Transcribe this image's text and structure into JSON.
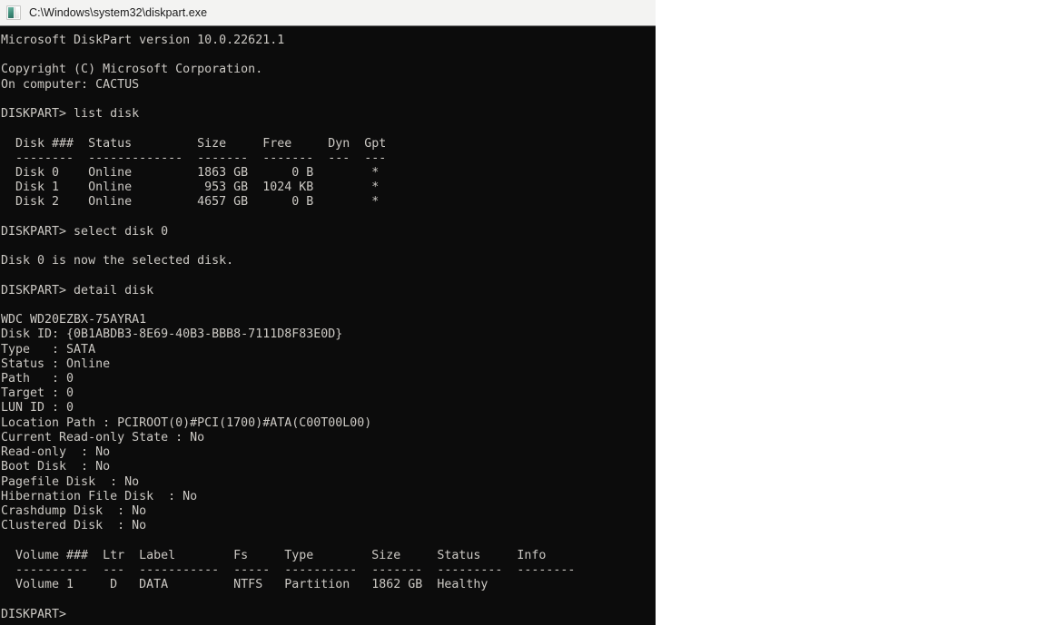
{
  "window": {
    "title": "C:\\Windows\\system32\\diskpart.exe",
    "icon": "console-icon",
    "background_color": "#0c0c0c",
    "title_bar_color": "#f3f3f2",
    "text_color": "#ccc9c4"
  },
  "console": {
    "header": {
      "version_line": "Microsoft DiskPart version 10.0.22621.1",
      "copyright": "Copyright (C) Microsoft Corporation.",
      "computer_line": "On computer: CACTUS",
      "computer_name": "CACTUS",
      "version": "10.0.22621.1"
    },
    "prompt": "DISKPART>",
    "commands": [
      "list disk",
      "select disk 0",
      "detail disk"
    ],
    "list_disk": {
      "headers": [
        "Disk ###",
        "Status",
        "Size",
        "Free",
        "Dyn",
        "Gpt"
      ],
      "separators": [
        "--------",
        "-------------",
        "-------",
        "-------",
        "---",
        "---"
      ],
      "rows": [
        {
          "disk": "Disk 0",
          "status": "Online",
          "size": "1863 GB",
          "free": "0 B",
          "dyn": "",
          "gpt": "*"
        },
        {
          "disk": "Disk 1",
          "status": "Online",
          "size": "953 GB",
          "free": "1024 KB",
          "dyn": "",
          "gpt": "*"
        },
        {
          "disk": "Disk 2",
          "status": "Online",
          "size": "4657 GB",
          "free": "0 B",
          "dyn": "",
          "gpt": "*"
        }
      ]
    },
    "select_disk_result": "Disk 0 is now the selected disk.",
    "detail_disk": {
      "model": "WDC WD20EZBX-75AYRA1",
      "disk_id_label": "Disk ID:",
      "disk_id": "{0B1ABDB3-8E69-40B3-BBB8-7111D8F83E0D}",
      "properties": [
        {
          "label": "Type",
          "value": "SATA"
        },
        {
          "label": "Status",
          "value": "Online"
        },
        {
          "label": "Path",
          "value": "0"
        },
        {
          "label": "Target",
          "value": "0"
        },
        {
          "label": "LUN ID",
          "value": "0"
        },
        {
          "label": "Location Path",
          "value": "PCIROOT(0)#PCI(1700)#ATA(C00T00L00)"
        },
        {
          "label": "Current Read-only State",
          "value": "No"
        },
        {
          "label": "Read-only",
          "value": "No"
        },
        {
          "label": "Boot Disk",
          "value": "No"
        },
        {
          "label": "Pagefile Disk",
          "value": "No"
        },
        {
          "label": "Hibernation File Disk",
          "value": "No"
        },
        {
          "label": "Crashdump Disk",
          "value": "No"
        },
        {
          "label": "Clustered Disk",
          "value": "No"
        }
      ],
      "volumes": {
        "headers": [
          "Volume ###",
          "Ltr",
          "Label",
          "Fs",
          "Type",
          "Size",
          "Status",
          "Info"
        ],
        "separators": [
          "----------",
          "---",
          "-----------",
          "-----",
          "----------",
          "-------",
          "---------",
          "--------"
        ],
        "rows": [
          {
            "volume": "Volume 1",
            "ltr": "D",
            "label": "DATA",
            "fs": "NTFS",
            "type": "Partition",
            "size": "1862 GB",
            "status": "Healthy",
            "info": ""
          }
        ]
      }
    },
    "trailing_prompt": "DISKPART>",
    "screen_text": "Microsoft DiskPart version 10.0.22621.1\n\nCopyright (C) Microsoft Corporation.\nOn computer: CACTUS\n\nDISKPART> list disk\n\n  Disk ###  Status         Size     Free     Dyn  Gpt\n  --------  -------------  -------  -------  ---  ---\n  Disk 0    Online         1863 GB      0 B        *\n  Disk 1    Online          953 GB  1024 KB        *\n  Disk 2    Online         4657 GB      0 B        *\n\nDISKPART> select disk 0\n\nDisk 0 is now the selected disk.\n\nDISKPART> detail disk\n\nWDC WD20EZBX-75AYRA1\nDisk ID: {0B1ABDB3-8E69-40B3-BBB8-7111D8F83E0D}\nType   : SATA\nStatus : Online\nPath   : 0\nTarget : 0\nLUN ID : 0\nLocation Path : PCIROOT(0)#PCI(1700)#ATA(C00T00L00)\nCurrent Read-only State : No\nRead-only  : No\nBoot Disk  : No\nPagefile Disk  : No\nHibernation File Disk  : No\nCrashdump Disk  : No\nClustered Disk  : No\n\n  Volume ###  Ltr  Label        Fs     Type        Size     Status     Info\n  ----------  ---  -----------  -----  ----------  -------  ---------  --------\n  Volume 1     D   DATA         NTFS   Partition   1862 GB  Healthy\n\nDISKPART>"
  }
}
